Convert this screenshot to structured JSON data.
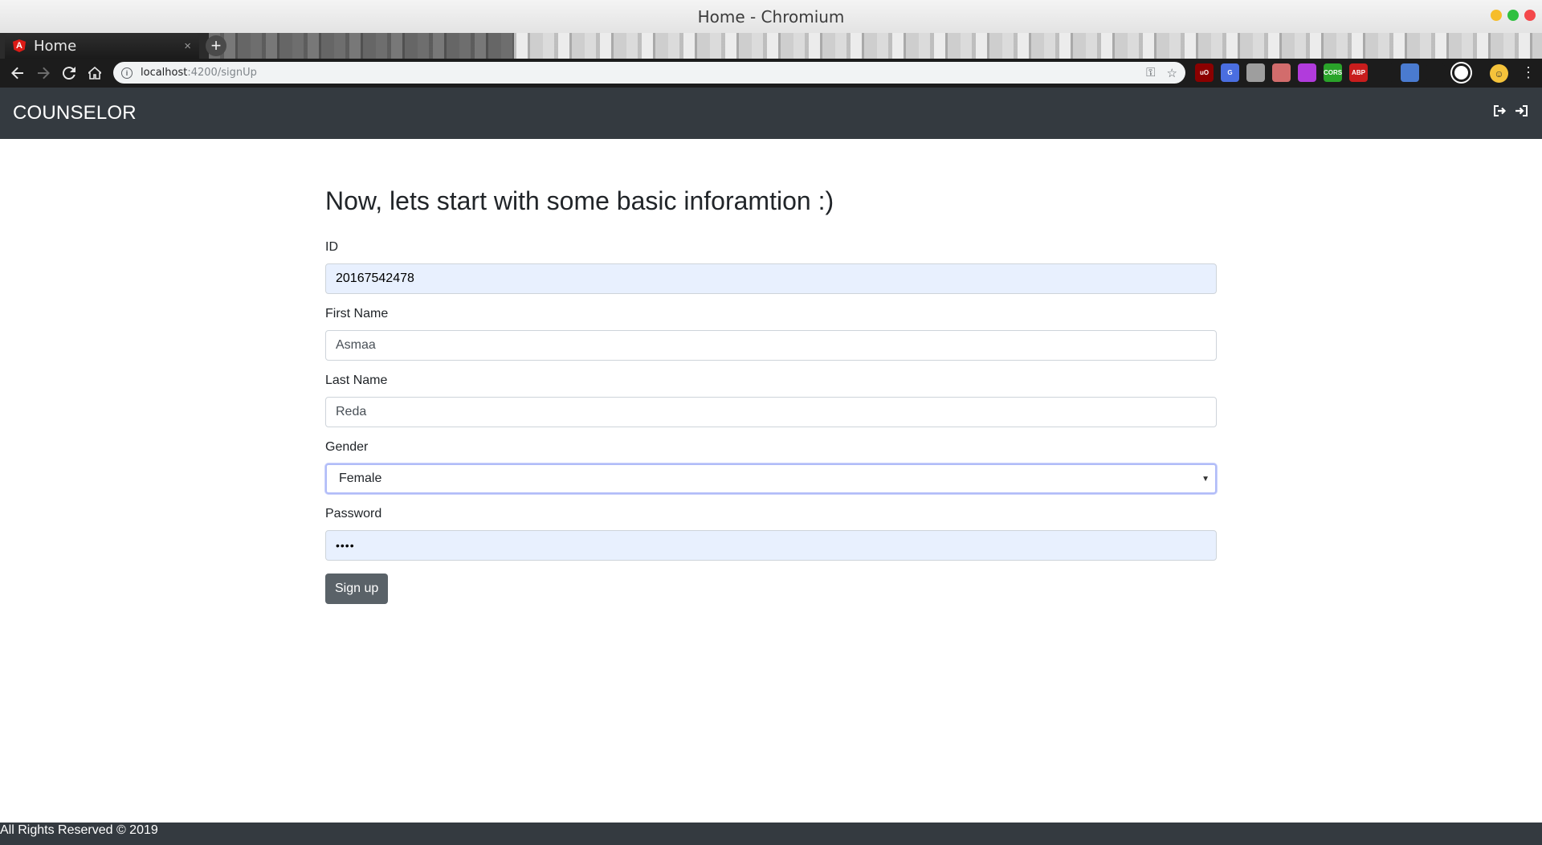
{
  "window": {
    "title": "Home - Chromium"
  },
  "browser": {
    "tab_title": "Home",
    "tab_close": "×",
    "new_tab": "+",
    "url_host": "localhost",
    "url_path": ":4200/signUp",
    "extensions": [
      {
        "name": "ublock-icon",
        "label": "uO",
        "color": "#8b0000"
      },
      {
        "name": "translate-icon",
        "label": "G",
        "color": "#4a6ee0"
      },
      {
        "name": "docs-icon",
        "label": "",
        "color": "#9e9e9e"
      },
      {
        "name": "pencil-icon",
        "label": "",
        "color": "#d26c6c"
      },
      {
        "name": "cat-icon",
        "label": "",
        "color": "#b13bdc"
      },
      {
        "name": "cors-icon",
        "label": "CORS",
        "color": "#2aa32a"
      },
      {
        "name": "abp-icon",
        "label": "ABP",
        "color": "#c81d1d"
      },
      {
        "name": "leaf-icon",
        "label": "",
        "color": "#1c1c1c"
      },
      {
        "name": "plane-icon",
        "label": "",
        "color": "#4a7bd0"
      },
      {
        "name": "download-icon",
        "label": "",
        "color": "#1c1c1c"
      },
      {
        "name": "chrome-icon",
        "label": "",
        "color": "#ffffff"
      }
    ]
  },
  "app": {
    "brand": "COUNSELOR",
    "heading": "Now, lets start with some basic inforamtion :)",
    "fields": {
      "id": {
        "label": "ID",
        "value": "20167542478"
      },
      "first_name": {
        "label": "First Name",
        "value": "Asmaa"
      },
      "last_name": {
        "label": "Last Name",
        "value": "Reda"
      },
      "gender": {
        "label": "Gender",
        "value": "Female"
      },
      "password": {
        "label": "Password",
        "value": "••••"
      }
    },
    "submit_label": "Sign up",
    "footer": "All Rights Reserved © 2019"
  }
}
